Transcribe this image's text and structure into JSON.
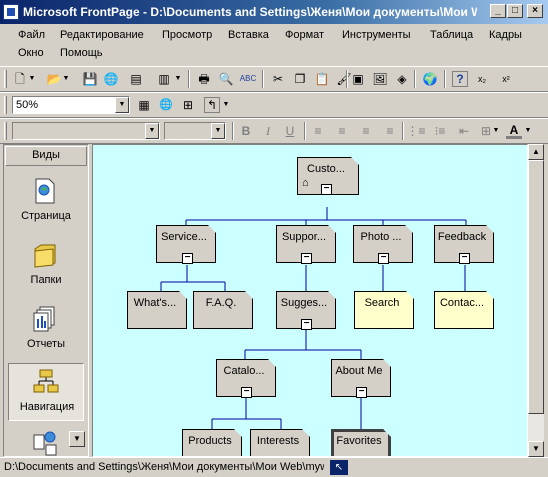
{
  "window": {
    "title": "Microsoft FrontPage - D:\\Documents and Settings\\Женя\\Мои документы\\Мои Web\\myweb",
    "minimize": "_",
    "maximize": "□",
    "close": "×"
  },
  "menu": [
    "Файл",
    "Редактирование",
    "Просмотр",
    "Вставка",
    "Формат",
    "Инструменты",
    "Таблица",
    "Кадры",
    "Окно",
    "Помощь"
  ],
  "toolbar2": {
    "zoom": "50%"
  },
  "format_toolbar": {
    "style": "",
    "font": ""
  },
  "views": {
    "header": "Виды",
    "items": [
      {
        "label": "Страница"
      },
      {
        "label": "Папки"
      },
      {
        "label": "Отчеты"
      },
      {
        "label": "Навигация"
      }
    ]
  },
  "navigation": {
    "home": "Custo...",
    "level1": [
      "Service...",
      "Suppor...",
      "Photo ...",
      "Feedback"
    ],
    "level2": [
      "What's...",
      "F.A.Q.",
      "Sugges...",
      "Search",
      "Contac..."
    ],
    "level3": [
      "Catalo...",
      "About Me"
    ],
    "level4": [
      "Products",
      "Interests",
      "Favorites"
    ]
  },
  "statusbar": {
    "path": "D:\\Documents and Settings\\Женя\\Мои документы\\Мои Web\\myweb"
  }
}
